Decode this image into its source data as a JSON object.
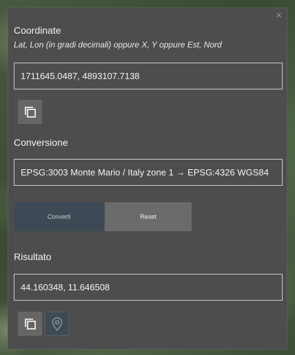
{
  "panel": {
    "close_icon": "close-icon",
    "close_glyph": "×"
  },
  "coordinates": {
    "label": "Coordinate",
    "hint": "Lat, Lon (in gradi decimali) oppure X, Y oppure Est, Nord",
    "value": "1711645.0487, 4893107.7138",
    "copy_icon": "copy-icon"
  },
  "conversion": {
    "label": "Conversione",
    "selected": "EPSG:3003 Monte Mario / Italy zone 1 → EPSG:4326 WGS84"
  },
  "actions": {
    "convert_label": "Converti",
    "reset_label": "Reset"
  },
  "result": {
    "label": "Risultato",
    "value": "44.160348, 11.646508",
    "copy_icon": "copy-icon",
    "locate_icon": "map-marker-icon"
  },
  "colors": {
    "panel_bg": "#4d4d4d",
    "convert_bg": "#3d4a55",
    "reset_bg": "#6b6b6b",
    "text": "#f2f2f2"
  }
}
